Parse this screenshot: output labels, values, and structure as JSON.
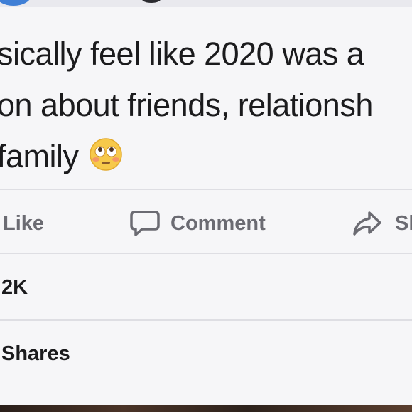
{
  "post": {
    "lines": [
      "sically feel like 2020 was a",
      "on about friends, relationsh",
      "family"
    ],
    "emoji": "flushed-face-emoji"
  },
  "actions": {
    "like_label": "Like",
    "comment_label": "Comment",
    "share_label": "Sh"
  },
  "stats": {
    "reactions_count": "2K",
    "shares_label": "Shares"
  },
  "colors": {
    "background": "#f6f6f8",
    "text": "#1b1b1d",
    "action_gray": "#6b6b72",
    "divider": "#dedee3",
    "emoji_yellow": "#f7c94a"
  }
}
